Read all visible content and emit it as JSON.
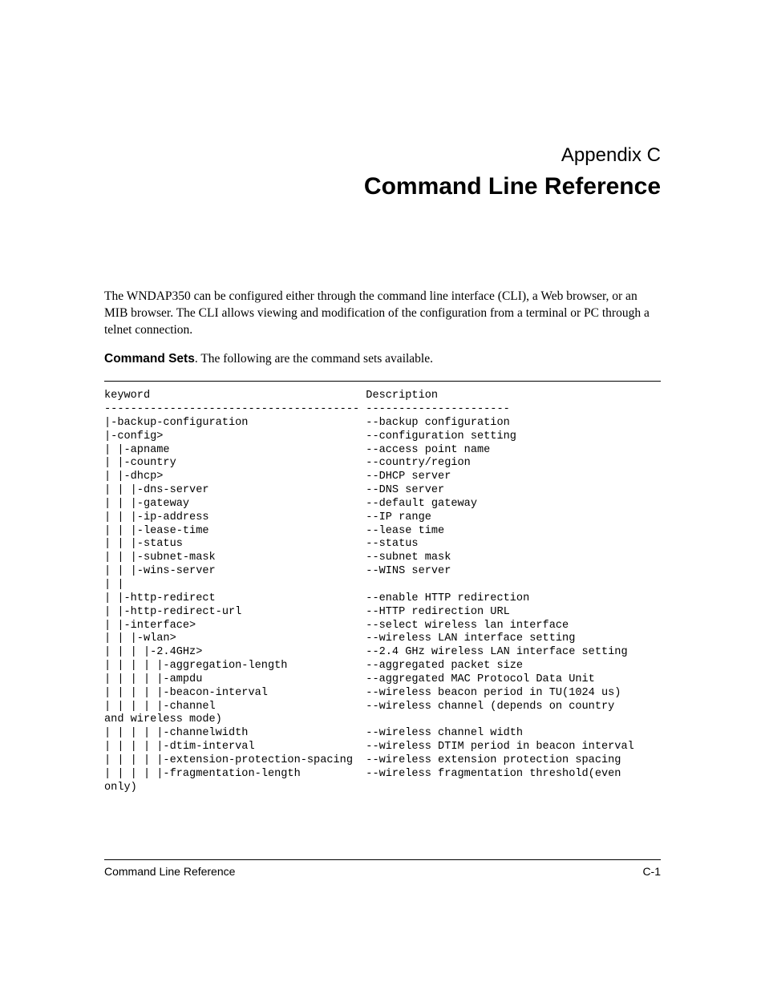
{
  "appendix": {
    "label": "Appendix C",
    "title": "Command Line Reference"
  },
  "intro": {
    "p1a": "The WNDAP350 can be configured either through the command line interface (CLI), a Web browser, or an MIB browser. The CLI allows viewing and modification of the configuration from a terminal or PC through a telnet connection.",
    "p2_label": "Command Sets",
    "p2_prefix": ". ",
    "p2_text": "The following are the command sets available."
  },
  "listing_lines": [
    "keyword                                 Description",
    "--------------------------------------- ----------------------",
    "|-backup-configuration                  --backup configuration",
    "|-config>                               --configuration setting",
    "| |-apname                              --access point name",
    "| |-country                             --country/region",
    "| |-dhcp>                               --DHCP server",
    "| | |-dns-server                        --DNS server",
    "| | |-gateway                           --default gateway",
    "| | |-ip-address                        --IP range",
    "| | |-lease-time                        --lease time",
    "| | |-status                            --status",
    "| | |-subnet-mask                       --subnet mask",
    "| | |-wins-server                       --WINS server",
    "| |",
    "| |-http-redirect                       --enable HTTP redirection",
    "| |-http-redirect-url                   --HTTP redirection URL",
    "| |-interface>                          --select wireless lan interface",
    "| | |-wlan>                             --wireless LAN interface setting",
    "| | | |-2.4GHz>                         --2.4 GHz wireless LAN interface setting",
    "| | | | |-aggregation-length            --aggregated packet size",
    "| | | | |-ampdu                         --aggregated MAC Protocol Data Unit",
    "| | | | |-beacon-interval               --wireless beacon period in TU(1024 us)",
    "| | | | |-channel                       --wireless channel (depends on country",
    "and wireless mode)",
    "| | | | |-channelwidth                  --wireless channel width",
    "| | | | |-dtim-interval                 --wireless DTIM period in beacon interval",
    "| | | | |-extension-protection-spacing  --wireless extension protection spacing",
    "| | | | |-fragmentation-length          --wireless fragmentation threshold(even",
    "only)"
  ],
  "footer": {
    "left": "Command Line Reference",
    "right": "C-1"
  }
}
